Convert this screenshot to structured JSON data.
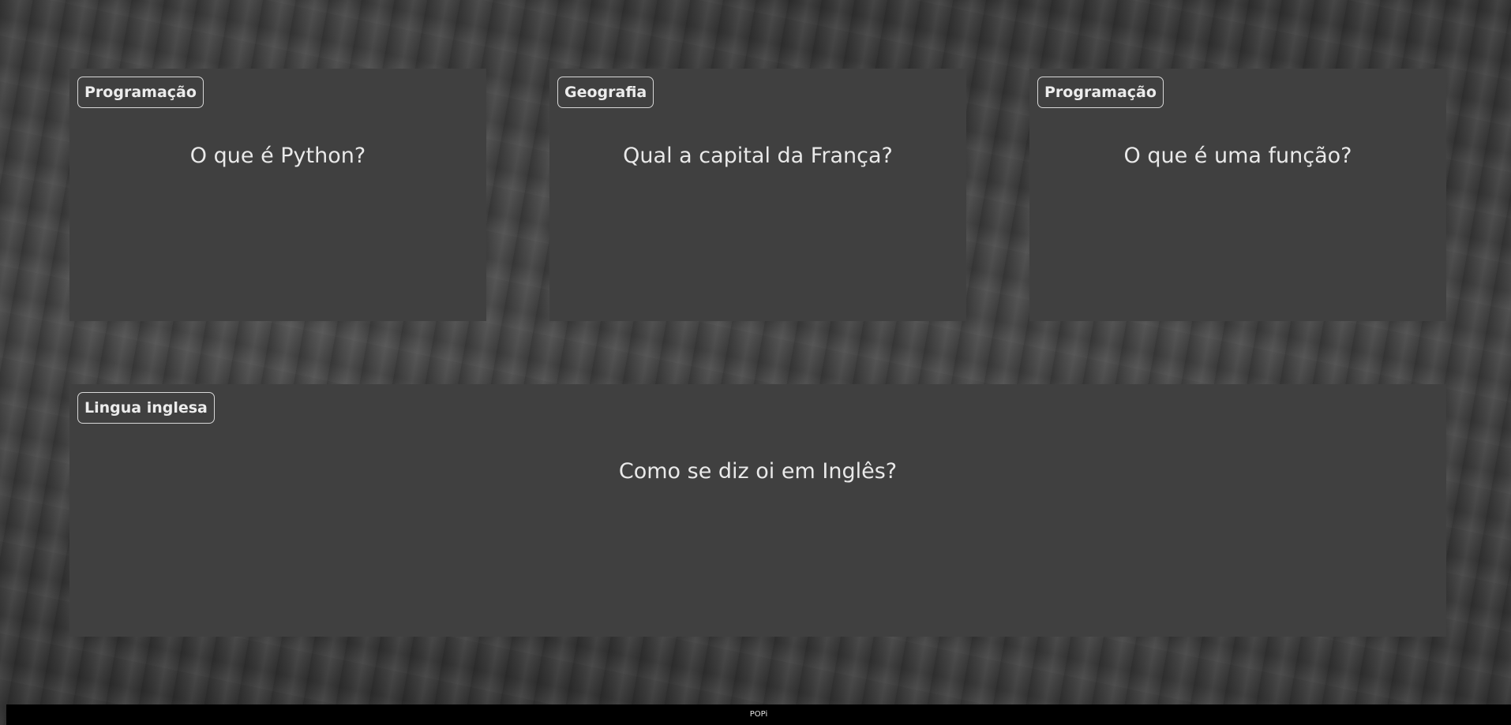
{
  "cards": [
    {
      "category": "Programação",
      "question": "O que é Python?"
    },
    {
      "category": "Geografia",
      "question": "Qual a capital da França?"
    },
    {
      "category": "Programação",
      "question": "O que é uma função?"
    },
    {
      "category": "Lingua inglesa",
      "question": "Como se diz oi em Inglês?"
    }
  ],
  "footer": {
    "text": "POPi"
  },
  "colors": {
    "card_background": "#404040",
    "text": "#e9e9e9",
    "footer_background": "#000000"
  }
}
